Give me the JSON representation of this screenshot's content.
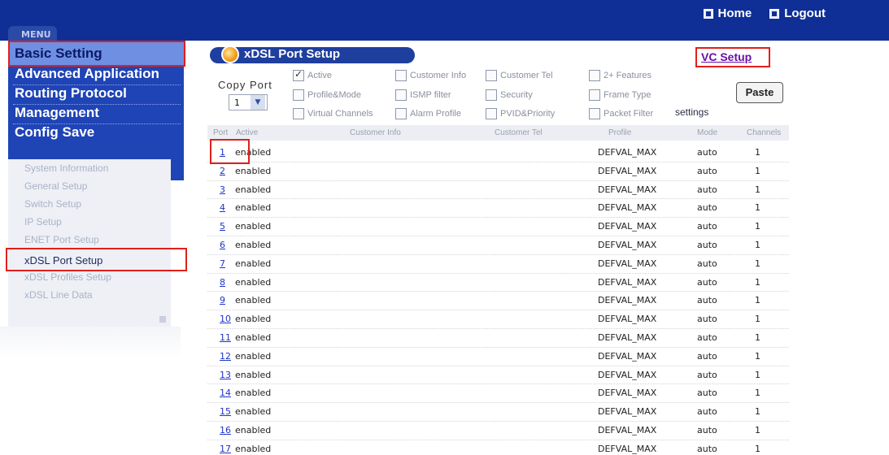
{
  "topnav": {
    "home": "Home",
    "logout": "Logout"
  },
  "sidebar": {
    "tab": "MENU",
    "menu": [
      "Basic Setting",
      "Advanced Application",
      "Routing Protocol",
      "Management",
      "Config Save"
    ],
    "submenu": [
      "System Information",
      "General Setup",
      "Switch Setup",
      "IP Setup",
      "ENET Port Setup",
      "xDSL Port Setup",
      "xDSL Profiles Setup",
      "xDSL Line Data"
    ],
    "active_menu": "Basic Setting",
    "active_submenu": "xDSL Port Setup"
  },
  "page": {
    "title": "xDSL Port Setup",
    "vc_setup": "VC Setup"
  },
  "copy": {
    "label": "Copy   Port",
    "selected_port": "1"
  },
  "checkboxes": [
    {
      "label": "Active",
      "checked": true
    },
    {
      "label": "Customer Info",
      "checked": false
    },
    {
      "label": "Customer Tel",
      "checked": false
    },
    {
      "label": "2+ Features",
      "checked": false
    },
    {
      "label": "Profile&Mode",
      "checked": false
    },
    {
      "label": "ISMP filter",
      "checked": false
    },
    {
      "label": "Security",
      "checked": false
    },
    {
      "label": "Frame Type",
      "checked": false
    },
    {
      "label": "Virtual Channels",
      "checked": false
    },
    {
      "label": "Alarm Profile",
      "checked": false
    },
    {
      "label": "PVID&Priority",
      "checked": false
    },
    {
      "label": "Packet Filter",
      "checked": false
    }
  ],
  "settings_label": "settings",
  "paste_label": "Paste",
  "table": {
    "headers": [
      "Port",
      "Active",
      "Customer Info",
      "Customer Tel",
      "Profile",
      "Mode",
      "Channels"
    ],
    "rows": [
      {
        "port": "1",
        "active": "enabled",
        "profile": "DEFVAL_MAX",
        "mode": "auto",
        "channels": "1"
      },
      {
        "port": "2",
        "active": "enabled",
        "profile": "DEFVAL_MAX",
        "mode": "auto",
        "channels": "1"
      },
      {
        "port": "3",
        "active": "enabled",
        "profile": "DEFVAL_MAX",
        "mode": "auto",
        "channels": "1"
      },
      {
        "port": "4",
        "active": "enabled",
        "profile": "DEFVAL_MAX",
        "mode": "auto",
        "channels": "1"
      },
      {
        "port": "5",
        "active": "enabled",
        "profile": "DEFVAL_MAX",
        "mode": "auto",
        "channels": "1"
      },
      {
        "port": "6",
        "active": "enabled",
        "profile": "DEFVAL_MAX",
        "mode": "auto",
        "channels": "1"
      },
      {
        "port": "7",
        "active": "enabled",
        "profile": "DEFVAL_MAX",
        "mode": "auto",
        "channels": "1"
      },
      {
        "port": "8",
        "active": "enabled",
        "profile": "DEFVAL_MAX",
        "mode": "auto",
        "channels": "1"
      },
      {
        "port": "9",
        "active": "enabled",
        "profile": "DEFVAL_MAX",
        "mode": "auto",
        "channels": "1"
      },
      {
        "port": "10",
        "active": "enabled",
        "profile": "DEFVAL_MAX",
        "mode": "auto",
        "channels": "1"
      },
      {
        "port": "11",
        "active": "enabled",
        "profile": "DEFVAL_MAX",
        "mode": "auto",
        "channels": "1"
      },
      {
        "port": "12",
        "active": "enabled",
        "profile": "DEFVAL_MAX",
        "mode": "auto",
        "channels": "1"
      },
      {
        "port": "13",
        "active": "enabled",
        "profile": "DEFVAL_MAX",
        "mode": "auto",
        "channels": "1"
      },
      {
        "port": "14",
        "active": "enabled",
        "profile": "DEFVAL_MAX",
        "mode": "auto",
        "channels": "1"
      },
      {
        "port": "15",
        "active": "enabled",
        "profile": "DEFVAL_MAX",
        "mode": "auto",
        "channels": "1"
      },
      {
        "port": "16",
        "active": "enabled",
        "profile": "DEFVAL_MAX",
        "mode": "auto",
        "channels": "1"
      },
      {
        "port": "17",
        "active": "enabled",
        "profile": "DEFVAL_MAX",
        "mode": "auto",
        "channels": "1"
      }
    ]
  }
}
